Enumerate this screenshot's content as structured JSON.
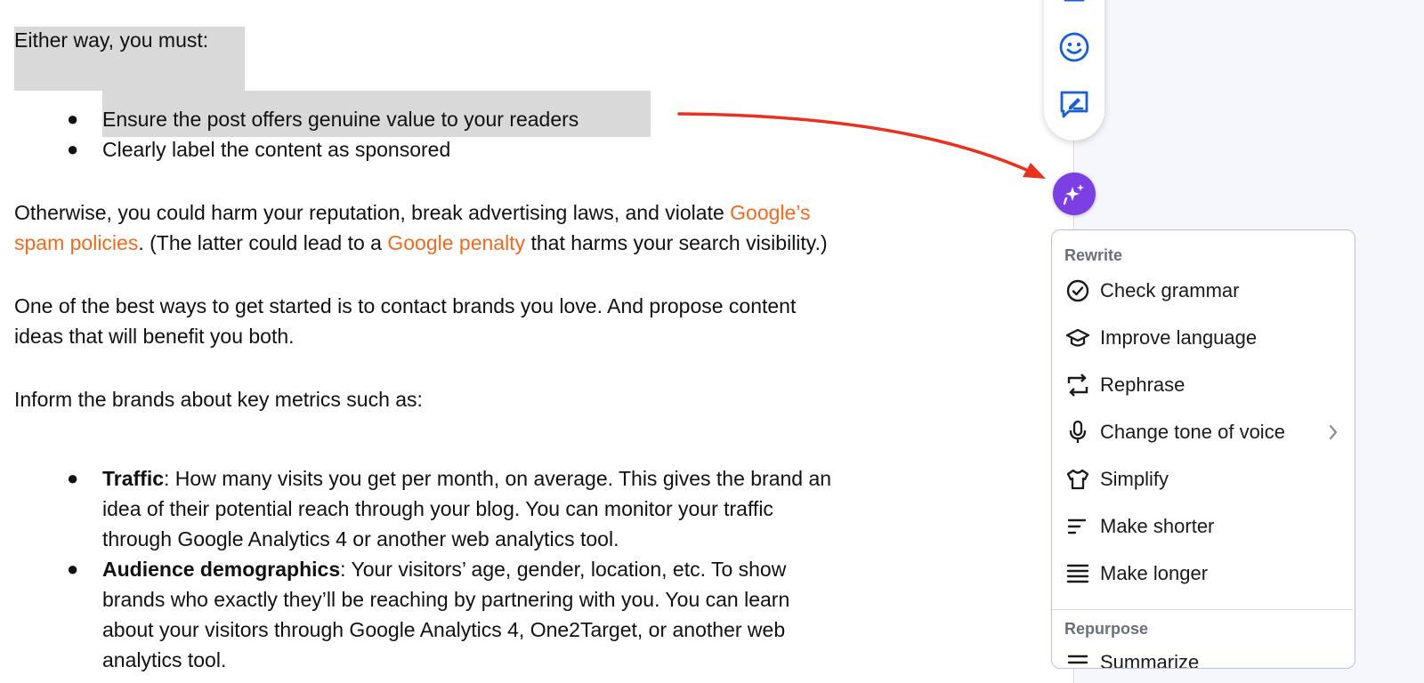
{
  "document": {
    "intro": "Either way, you must:",
    "list1": [
      "Ensure the post offers genuine value to your readers",
      "Clearly label the content as sponsored"
    ],
    "para1": {
      "part1": "Otherwise, you could harm your reputation, break advertising laws, and violate ",
      "link1a": "Google’s",
      "link1b": "spam policies",
      "part2": ". (The latter could lead to a ",
      "link2": "Google penalty",
      "part3": " that harms your search visibility.)"
    },
    "para2": {
      "line1": "One of the best ways to get started is to contact brands you love. And propose content",
      "line2": "ideas that will benefit you both."
    },
    "para3": "Inform the brands about key metrics such as:",
    "list2": [
      {
        "term": "Traffic",
        "line1": ": How many visits you get per month, on average. This gives the brand an",
        "line2": "idea of their potential reach through your blog. You can monitor your traffic",
        "line3": "through Google Analytics 4 or another web analytics tool."
      },
      {
        "term": "Audience demographics",
        "line1": ": Your visitors’ age, gender, location, etc. To show",
        "line2": "brands who exactly they’ll be reaching by partnering with you. You can learn",
        "line3": "about your visitors through Google Analytics 4, One2Target, or another web",
        "line4": "analytics tool."
      }
    ]
  },
  "toolbar": {
    "icons": [
      "send-icon",
      "emoji-icon",
      "edit-note-icon"
    ]
  },
  "ai_button": {
    "icon": "sparkle-chat-icon"
  },
  "menu": {
    "rewrite_label": "Rewrite",
    "items": [
      {
        "label": "Check grammar",
        "icon": "check-circle-icon"
      },
      {
        "label": "Improve language",
        "icon": "graduation-cap-icon"
      },
      {
        "label": "Rephrase",
        "icon": "rephrase-arrows-icon"
      },
      {
        "label": "Change tone of voice",
        "icon": "microphone-icon"
      },
      {
        "label": "Simplify",
        "icon": "tshirt-icon"
      },
      {
        "label": "Make shorter",
        "icon": "short-lines-icon"
      },
      {
        "label": "Make longer",
        "icon": "long-lines-icon"
      }
    ],
    "repurpose_label": "Repurpose",
    "repurpose_items": [
      {
        "label": "Summarize",
        "icon": "summarize-icon"
      }
    ]
  },
  "colors": {
    "link": "#f06a1d",
    "accent": "#7b3fe4",
    "toolbar_icon": "#1a5fd1",
    "arrow": "#e8311e",
    "selection": "#d9d9d9"
  }
}
